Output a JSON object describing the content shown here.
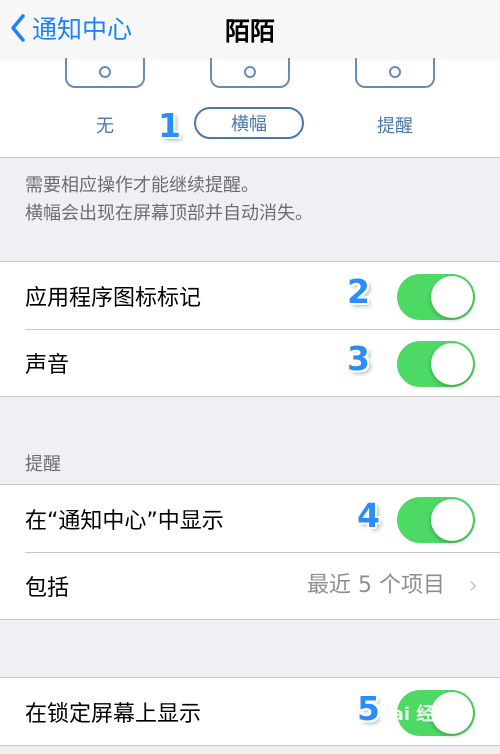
{
  "navbar": {
    "back_label": "通知中心",
    "title": "陌陌"
  },
  "alert_style": {
    "options": [
      "无",
      "横幅",
      "提醒"
    ],
    "selected": "横幅"
  },
  "annotations": [
    "1",
    "2",
    "3",
    "4",
    "5"
  ],
  "note": {
    "line1": "需要相应操作才能继续提醒。",
    "line2": "横幅会出现在屏幕顶部并自动消失。"
  },
  "group1": {
    "badge_label": "应用程序图标标记",
    "badge_on": true,
    "sound_label": "声音",
    "sound_on": true
  },
  "alerts_header": "提醒",
  "group2": {
    "show_in_center_label": "在“通知中心”中显示",
    "show_in_center_on": true,
    "include_label": "包括",
    "include_value": "最近 5 个项目"
  },
  "group3": {
    "lock_screen_label": "在锁定屏幕上显示",
    "lock_screen_on": true
  },
  "watermark": "Bai 经验",
  "colors": {
    "accent": "#1a82fb",
    "toggle_on": "#4cd964",
    "annotation": "#2a8ef5"
  }
}
